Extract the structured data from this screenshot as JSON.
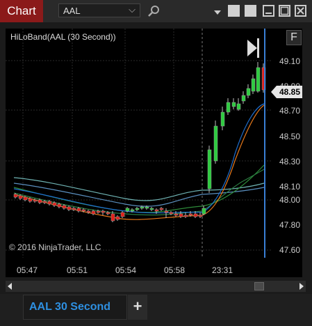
{
  "toolbar": {
    "chart_tab_label": "Chart",
    "instrument_value": "AAL",
    "icons": [
      "search-icon",
      "menu-caret-icon",
      "tile-icon",
      "tile-icon",
      "minimize-icon",
      "maximize-icon",
      "close-icon"
    ]
  },
  "chart": {
    "indicator_label": "HiLoBand(AAL (30 Second))",
    "copyright": "© 2016 NinjaTrader, LLC",
    "format_button_label": "F",
    "current_price": "48.85",
    "price_axis": [
      "49.10",
      "48.90",
      "48.70",
      "48.50",
      "48.30",
      "48.10",
      "48.00",
      "47.80",
      "47.60"
    ],
    "time_axis": [
      "05:47",
      "05:51",
      "05:54",
      "05:58",
      "23:31"
    ],
    "colors": {
      "up": "#2ecc40",
      "down": "#e0201a",
      "accent": "#3399ff"
    }
  },
  "bottom_tabs": {
    "active_tab_label": "AAL 30 Second",
    "add_tab_label": "+"
  }
}
